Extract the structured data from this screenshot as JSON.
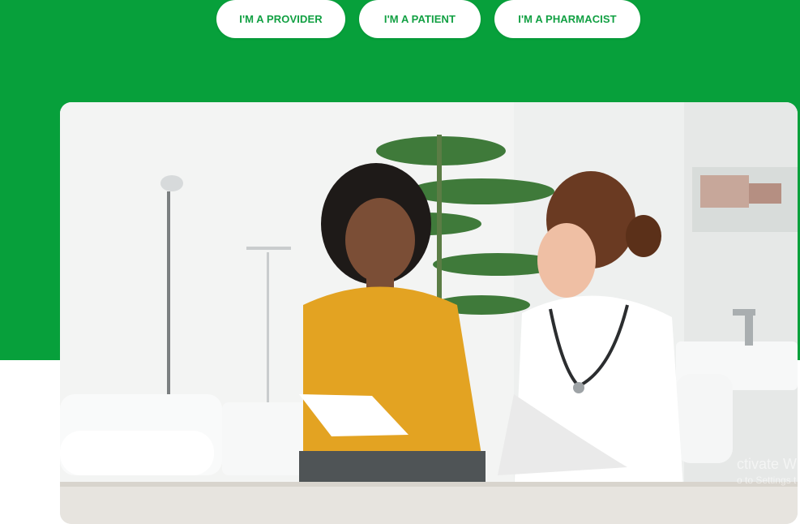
{
  "role_buttons": {
    "provider": "I'M A PROVIDER",
    "patient": "I'M A PATIENT",
    "pharmacist": "I'M A PHARMACIST"
  },
  "hero": {
    "image_subject": "patient-and-doctor-consultation-photo"
  },
  "watermark": {
    "line1": "ctivate Wi",
    "line2": "o to Settings t"
  },
  "colors": {
    "brand_green": "#07a03b",
    "button_text": "#12a043",
    "button_bg": "#ffffff"
  }
}
